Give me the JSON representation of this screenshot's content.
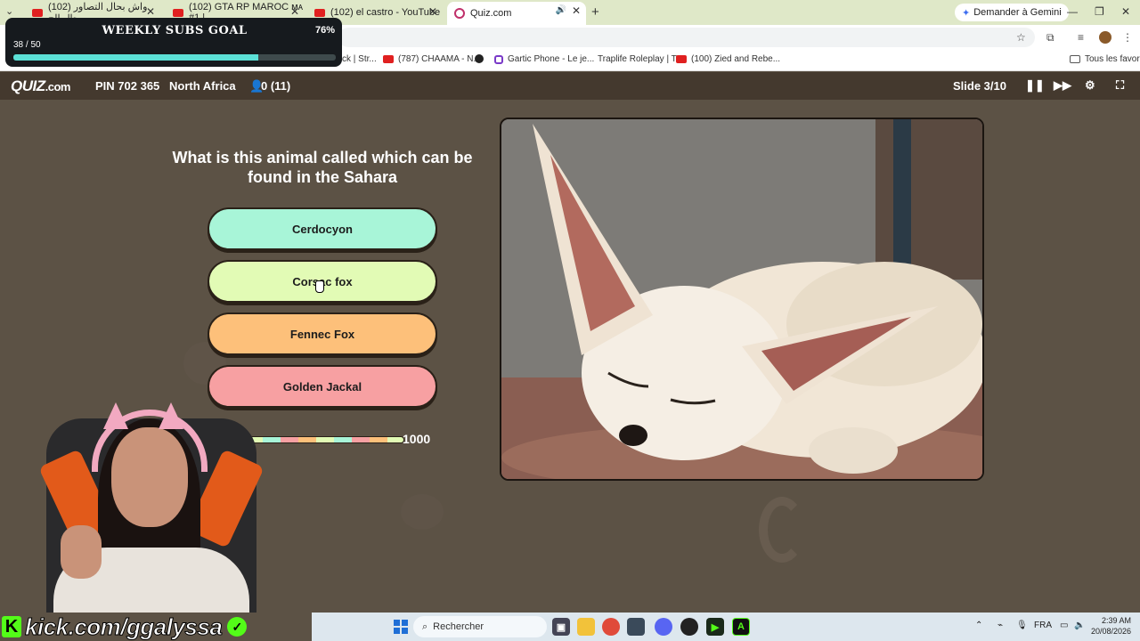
{
  "browser": {
    "tabs": [
      {
        "title": "(102) واش بحال التصاور بحال الح",
        "icon": "youtube-icon"
      },
      {
        "title": "(102) GTA RP MAROC ᴍᴀ #1 | ...",
        "icon": "youtube-icon"
      },
      {
        "title": "(102) el castro - YouTube",
        "icon": "youtube-icon"
      },
      {
        "title": "Quiz.com",
        "icon": "quiz-icon"
      }
    ],
    "gemini_label": "Demander à Gemini",
    "bookmarks": [
      {
        "label": "ck | Str...",
        "icon": "link-icon"
      },
      {
        "label": "(787) CHAAMA - N...",
        "icon": "youtube-icon"
      },
      {
        "label": "",
        "icon": "globe-icon"
      },
      {
        "label": "Gartic Phone - Le je...",
        "icon": "gartic-icon"
      },
      {
        "label": "Traplife Roleplay | T...",
        "icon": "link-icon"
      },
      {
        "label": "(100) Zied and Rebe...",
        "icon": "youtube-icon"
      }
    ],
    "all_bookmarks_label": "Tous les favoris"
  },
  "subs_goal": {
    "title": "WEEKLY SUBS GOAL",
    "percent_label": "76%",
    "count_label": "38 / 50",
    "progress": 0.76,
    "fill_color": "#5be0d6"
  },
  "quiz": {
    "logo": "QUIZ",
    "logo_suffix": ".com",
    "pin": "PIN 702 365",
    "region": "North Africa",
    "players": "0 (11)",
    "slide": "Slide 3/10",
    "question": "What is this animal called which can be found in the Sahara",
    "answers": [
      {
        "label": "Cerdocyon",
        "color": "#a8f5d8"
      },
      {
        "label": "Corsac fox",
        "color": "#e2fbb5"
      },
      {
        "label": "Fennec Fox",
        "color": "#fdc07a"
      },
      {
        "label": "Golden Jackal",
        "color": "#f7a0a2"
      }
    ],
    "points": "1000",
    "points_progress": 1.0
  },
  "stream": {
    "url": "kick.com/ggalyssa",
    "brand_letter": "K",
    "brand_color": "#53fc18"
  },
  "taskbar": {
    "search_placeholder": "Rechercher",
    "language": "FRA",
    "time": "2:39 AM",
    "date": "20/08/2026"
  }
}
